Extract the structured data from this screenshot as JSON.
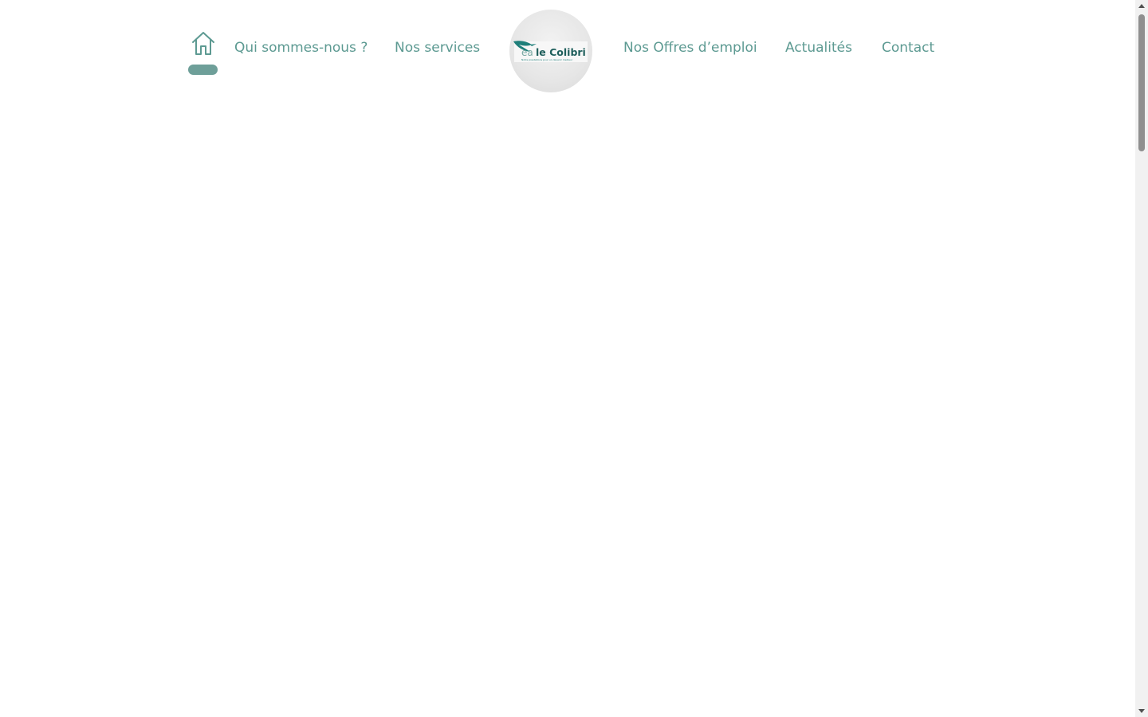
{
  "nav": {
    "home_icon": "home-icon",
    "links_left": [
      "Qui sommes-nous ?",
      "Nos services"
    ],
    "links_right": [
      "Nos Offres d’emploi",
      "Actualités",
      "Contact"
    ]
  },
  "logo": {
    "text_prefix": "ea",
    "text_main": "le Colibri",
    "tagline": "Notre prestations pour un devenir meilleur"
  },
  "colors": {
    "accent": "#5d9a92",
    "indicator": "#6e9f99",
    "logo_brand": "#1f7f7a"
  }
}
